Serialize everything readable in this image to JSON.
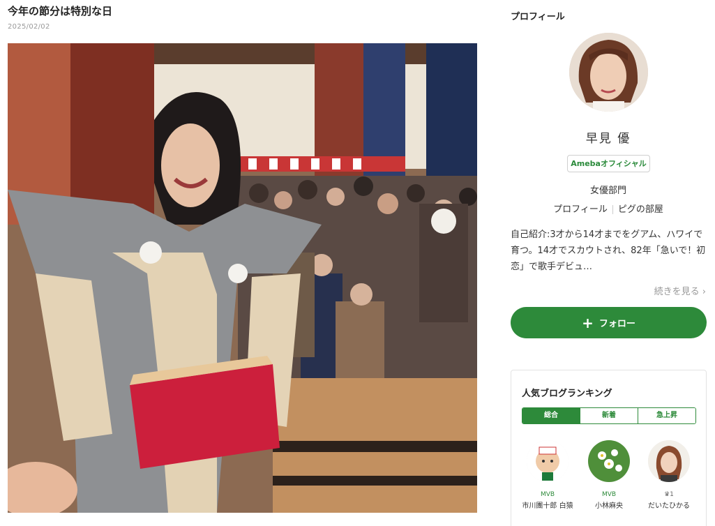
{
  "article": {
    "title": "今年の節分は特別な日",
    "date": "2025/02/02"
  },
  "sidebar": {
    "heading": "プロフィール",
    "profile": {
      "name": "早見 優",
      "badge": "Amebaオフィシャル",
      "category": "女優部門",
      "links": [
        "プロフィール",
        "ピグの部屋"
      ],
      "intro": "自己紹介:3才から14才までをグアム、ハワイで育つ。14才でスカウトされ、82年「急いで！初恋」で歌手デビュ…",
      "read_more": "続きを見る",
      "follow_label": "フォロー"
    },
    "ranking": {
      "title": "人気ブログランキング",
      "tabs": [
        "総合",
        "新着",
        "急上昇"
      ],
      "active_tab": "総合",
      "items": [
        {
          "badge": "MVB",
          "name": "市川團十郎 白猿"
        },
        {
          "badge": "MVB",
          "name": "小林麻央"
        },
        {
          "badge": "1",
          "name": "だいたひかる"
        }
      ]
    }
  },
  "colors": {
    "accent_green": "#2d8a3a",
    "muted_text": "#999999"
  },
  "icons": {
    "follow": "plus-icon",
    "read_more": "chevron-right-icon",
    "rank_crown": "crown-icon"
  }
}
